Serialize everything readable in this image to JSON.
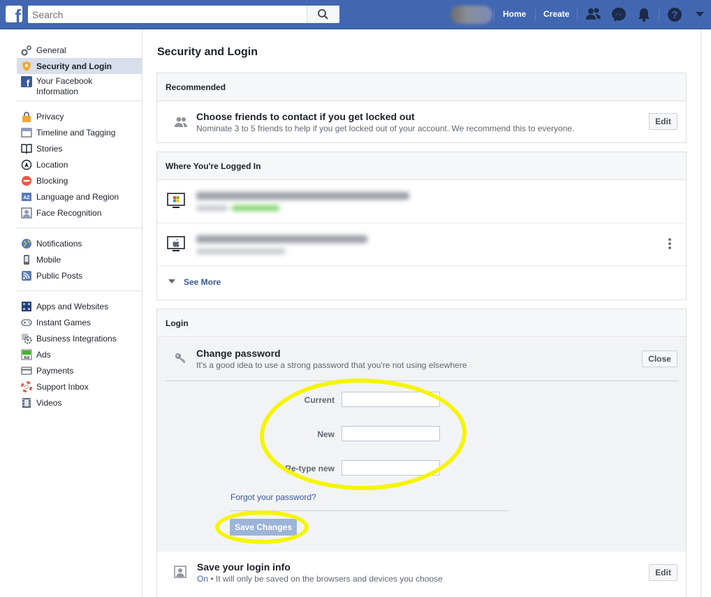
{
  "topbar": {
    "search_placeholder": "Search",
    "nav": [
      "Home",
      "Create"
    ]
  },
  "sidebar": {
    "group1": [
      {
        "label": "General",
        "icon": "gear-icon"
      },
      {
        "label": "Security and Login",
        "icon": "shield-icon",
        "active": true
      },
      {
        "label": "Your Facebook Information",
        "icon": "facebook-icon"
      }
    ],
    "group2": [
      {
        "label": "Privacy",
        "icon": "lock-icon"
      },
      {
        "label": "Timeline and Tagging",
        "icon": "timeline-icon"
      },
      {
        "label": "Stories",
        "icon": "book-icon"
      },
      {
        "label": "Location",
        "icon": "location-icon"
      },
      {
        "label": "Blocking",
        "icon": "block-icon"
      },
      {
        "label": "Language and Region",
        "icon": "language-icon"
      },
      {
        "label": "Face Recognition",
        "icon": "face-icon"
      }
    ],
    "group3": [
      {
        "label": "Notifications",
        "icon": "globe-icon"
      },
      {
        "label": "Mobile",
        "icon": "phone-icon"
      },
      {
        "label": "Public Posts",
        "icon": "rss-icon"
      }
    ],
    "group4": [
      {
        "label": "Apps and Websites",
        "icon": "apps-icon"
      },
      {
        "label": "Instant Games",
        "icon": "gamepad-icon"
      },
      {
        "label": "Business Integrations",
        "icon": "cog-icon"
      },
      {
        "label": "Ads",
        "icon": "ads-icon"
      },
      {
        "label": "Payments",
        "icon": "card-icon"
      },
      {
        "label": "Support Inbox",
        "icon": "lifebuoy-icon"
      },
      {
        "label": "Videos",
        "icon": "film-icon"
      }
    ]
  },
  "main": {
    "title": "Security and Login",
    "recommended": {
      "header": "Recommended",
      "title": "Choose friends to contact if you get locked out",
      "desc": "Nominate 3 to 5 friends to help if you get locked out of your account. We recommend this to everyone.",
      "edit": "Edit"
    },
    "logged_in": {
      "header": "Where You're Logged In",
      "see_more": "See More"
    },
    "login": {
      "header": "Login",
      "change_title": "Change password",
      "change_desc": "It's a good idea to use a strong password that you're not using elsewhere",
      "close": "Close",
      "current_label": "Current",
      "new_label": "New",
      "retype_label": "Re-type new",
      "forgot": "Forgot your password?",
      "save": "Save Changes",
      "save_info_title": "Save your login info",
      "save_info_on": "On",
      "save_info_desc": " • It will only be saved on the browsers and devices you choose",
      "save_info_edit": "Edit"
    }
  },
  "colors": {
    "brand": "#4267b2",
    "link": "#365899",
    "highlight": "#f5f500"
  }
}
